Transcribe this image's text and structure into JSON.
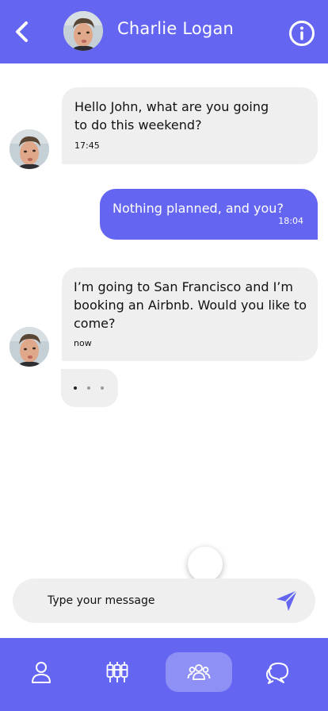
{
  "header": {
    "contact_name": "Charlie Logan",
    "back_icon": "chevron-left-icon",
    "info_icon": "info-icon"
  },
  "messages": [
    {
      "direction": "incoming",
      "text": "Hello John, what are you going to do this weekend?",
      "time": "17:45"
    },
    {
      "direction": "outgoing",
      "text": "Nothing planned, and you?",
      "time": "18:04"
    },
    {
      "direction": "incoming",
      "text": "I’m going to San Francisco and I’m booking an Airbnb. Would you like to come?",
      "time": "now"
    }
  ],
  "composer": {
    "placeholder": "Type your message",
    "send_icon": "send-icon"
  },
  "nav": {
    "items": [
      {
        "icon": "user-icon",
        "active": false
      },
      {
        "icon": "cable-car-icon",
        "active": false
      },
      {
        "icon": "group-icon",
        "active": true
      },
      {
        "icon": "chat-bubbles-icon",
        "active": false
      }
    ]
  },
  "colors": {
    "accent": "#6466f1",
    "bubble_incoming": "#efefef",
    "white": "#ffffff"
  }
}
